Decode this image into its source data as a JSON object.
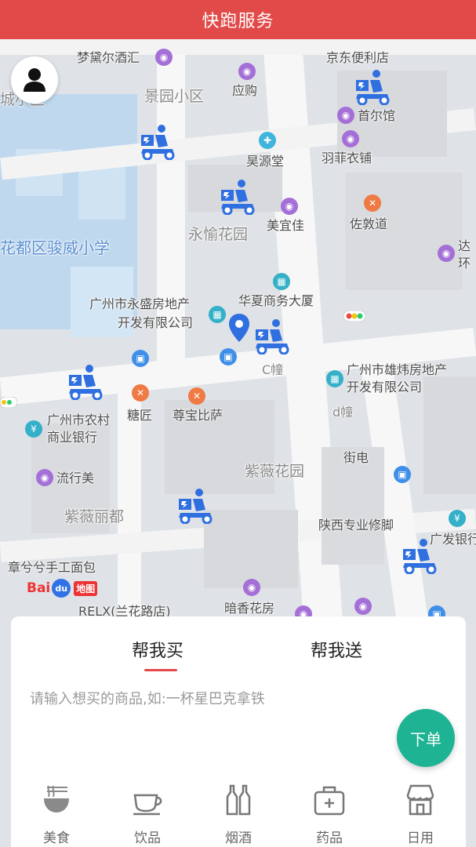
{
  "header": {
    "title": "快跑服务"
  },
  "map": {
    "labels": {
      "mengdai": "梦黛尔酒汇",
      "jingdong": "京东便利店",
      "jingyuan": "景园小区",
      "yinggou": "应购",
      "chengxiaoqu": "城小区",
      "shouer": "首尔馆",
      "haoyuantang": "昊源堂",
      "yufei": "羽菲衣铺",
      "meiyijia": "美宜佳",
      "yongyu": "永愉花园",
      "zuodun": "佐敦道",
      "junwei": "花都区骏威小学",
      "daji": "达",
      "huan": "环",
      "yongsheng1": "广州市永盛房地产",
      "yongsheng2": "开发有限公司",
      "huaxia": "华夏商务大厦",
      "cchuang": "C幢",
      "xiongwei1": "广州市雄炜房地产",
      "xiongwei2": "开发有限公司",
      "nongcun1": "广州市农村",
      "nongcun2": "商业银行",
      "tangjiang": "糖匠",
      "zunbao": "尊宝比萨",
      "dchuang": "d幢",
      "jiedian": "街电",
      "liuxingmei": "流行美",
      "ziwei": "紫薇花园",
      "ziweilidu": "紫薇丽都",
      "shaanxi": "陕西专业修脚",
      "guangfa": "广发银行",
      "mian": "章兮兮手工面包",
      "relx": "RELX(兰花路店)",
      "anxiang": "暗香花房"
    },
    "baidu_logo": {
      "bai": "Bai",
      "du": "du",
      "ditu": "地图"
    }
  },
  "panel": {
    "tabs": [
      {
        "label": "帮我买",
        "active": true
      },
      {
        "label": "帮我送",
        "active": false
      }
    ],
    "search_placeholder": "请输入想买的商品,如:一杯星巴克拿铁",
    "order_button": "下单",
    "categories": [
      {
        "label": "美食",
        "icon": "noodle-bowl-icon"
      },
      {
        "label": "饮品",
        "icon": "coffee-cup-icon"
      },
      {
        "label": "烟酒",
        "icon": "bottles-icon"
      },
      {
        "label": "药品",
        "icon": "medicine-kit-icon"
      },
      {
        "label": "日用",
        "icon": "store-icon"
      }
    ]
  },
  "colors": {
    "header": "#e24a49",
    "accent": "#1db393",
    "rider": "#2f6fe0"
  }
}
